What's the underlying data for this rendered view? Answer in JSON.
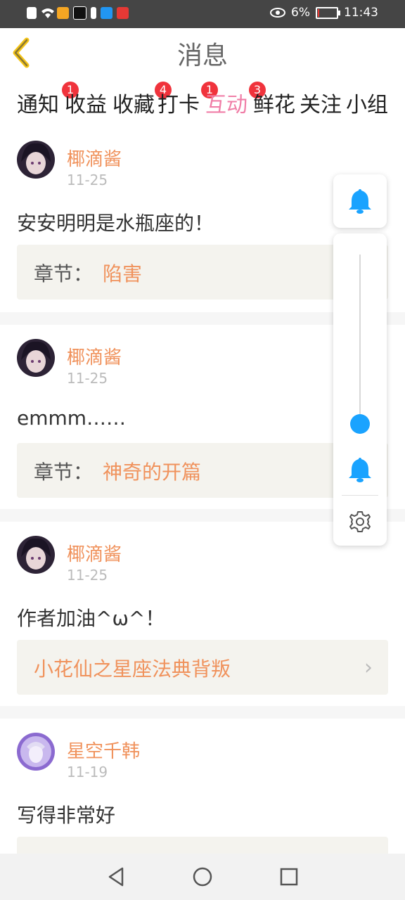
{
  "statusbar": {
    "battery": "6%",
    "time": "11:43"
  },
  "header": {
    "title": "消息"
  },
  "tabs": [
    {
      "label": "通知",
      "badge": "1"
    },
    {
      "label": "收益",
      "badge": ""
    },
    {
      "label": "收藏",
      "badge": "4"
    },
    {
      "label": "打卡",
      "badge": "1"
    },
    {
      "label": "互动",
      "badge": "3",
      "active": true
    },
    {
      "label": "鲜花",
      "badge": ""
    },
    {
      "label": "关注",
      "badge": ""
    },
    {
      "label": "小组",
      "badge": ""
    }
  ],
  "comments": [
    {
      "user": "椰滴酱",
      "date": "11-25",
      "text": "安安明明是水瓶座的！",
      "chapter_label": "章节：",
      "chapter": "陷害"
    },
    {
      "user": "椰滴酱",
      "date": "11-25",
      "text": "emmm……",
      "chapter_label": "章节：",
      "chapter": "神奇的开篇"
    },
    {
      "user": "椰滴酱",
      "date": "11-25",
      "text": "作者加油^ω^！",
      "chapter_label": "",
      "chapter": "小花仙之星座法典背叛"
    },
    {
      "user": "星空千韩",
      "date": "11-19",
      "text": "写得非常好",
      "chapter_label": "",
      "chapter": ""
    }
  ],
  "colors": {
    "accent_pink": "#f07ea7",
    "name_orange": "#f0925c",
    "badge_red": "#f0333c",
    "bell_blue": "#1aa3ff"
  },
  "volume_panel": {
    "level": 0.2
  }
}
